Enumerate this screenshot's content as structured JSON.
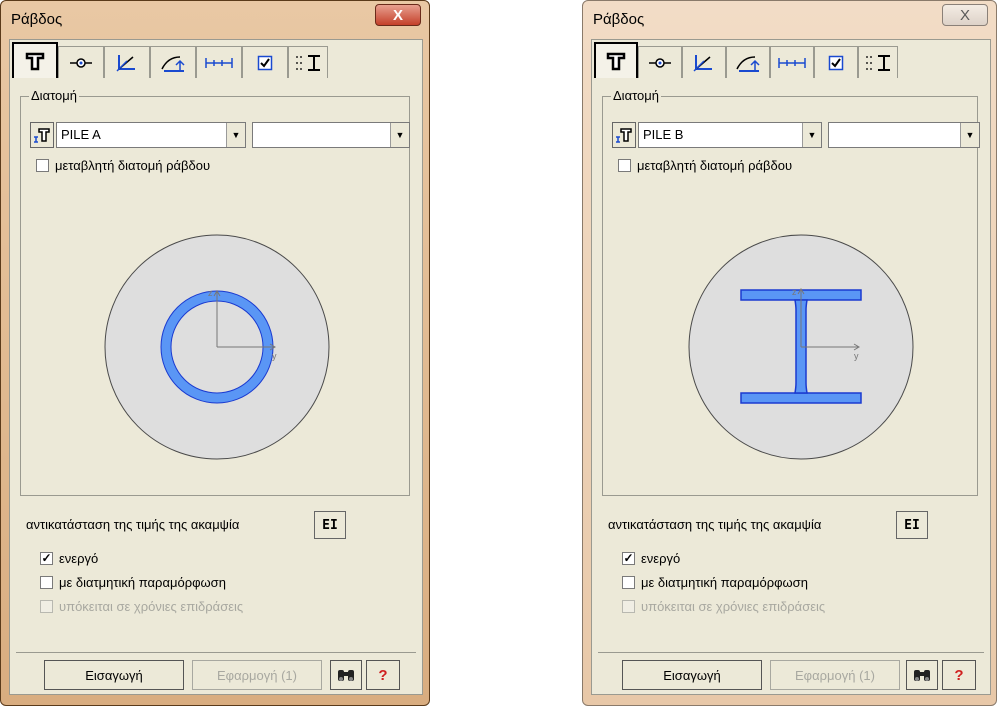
{
  "windows": [
    {
      "title": "Ράβδος",
      "close_label": "X",
      "section_label": "Διατομή",
      "section_value": "PILE A",
      "secondary_value": "",
      "variable_section_label": "μεταβλητή διατομή ράβδου",
      "variable_section_checked": false,
      "section_shape": "circular-tube",
      "axis_y_label": "y",
      "axis_z_label": "z",
      "ei_text": "αντικατάσταση της τιμής της ακαμψία",
      "ei_button": "EI",
      "active_label": "ενεργό",
      "active_checked": true,
      "shear_label": "με διατμητική παραμόρφωση",
      "shear_checked": false,
      "time_label": "υπόκειται σε χρόνιες επιδράσεις",
      "time_checked": false,
      "insert_label": "Εισαγωγή",
      "apply_label": "Εφαρμογή (1)",
      "help_label": "?"
    },
    {
      "title": "Ράβδος",
      "close_label": "X",
      "section_label": "Διατομή",
      "section_value": "PILE B",
      "secondary_value": "",
      "variable_section_label": "μεταβλητή διατομή ράβδου",
      "variable_section_checked": false,
      "section_shape": "i-beam",
      "axis_y_label": "y",
      "axis_z_label": "z",
      "ei_text": "αντικατάσταση της τιμής της ακαμψία",
      "ei_button": "EI",
      "active_label": "ενεργό",
      "active_checked": true,
      "shear_label": "με διατμητική παραμόρφωση",
      "shear_checked": false,
      "time_label": "υπόκειται σε χρόνιες επιδράσεις",
      "time_checked": false,
      "insert_label": "Εισαγωγή",
      "apply_label": "Εφαρμογή (1)",
      "help_label": "?"
    }
  ],
  "tab_icons": [
    "section-icon",
    "node-icon",
    "local-axes-icon",
    "release-icon",
    "length-icon",
    "checkbox-icon",
    "dimension-icon"
  ],
  "colors": {
    "section_blue": "#4a86f0",
    "accent_help": "#d02020"
  }
}
